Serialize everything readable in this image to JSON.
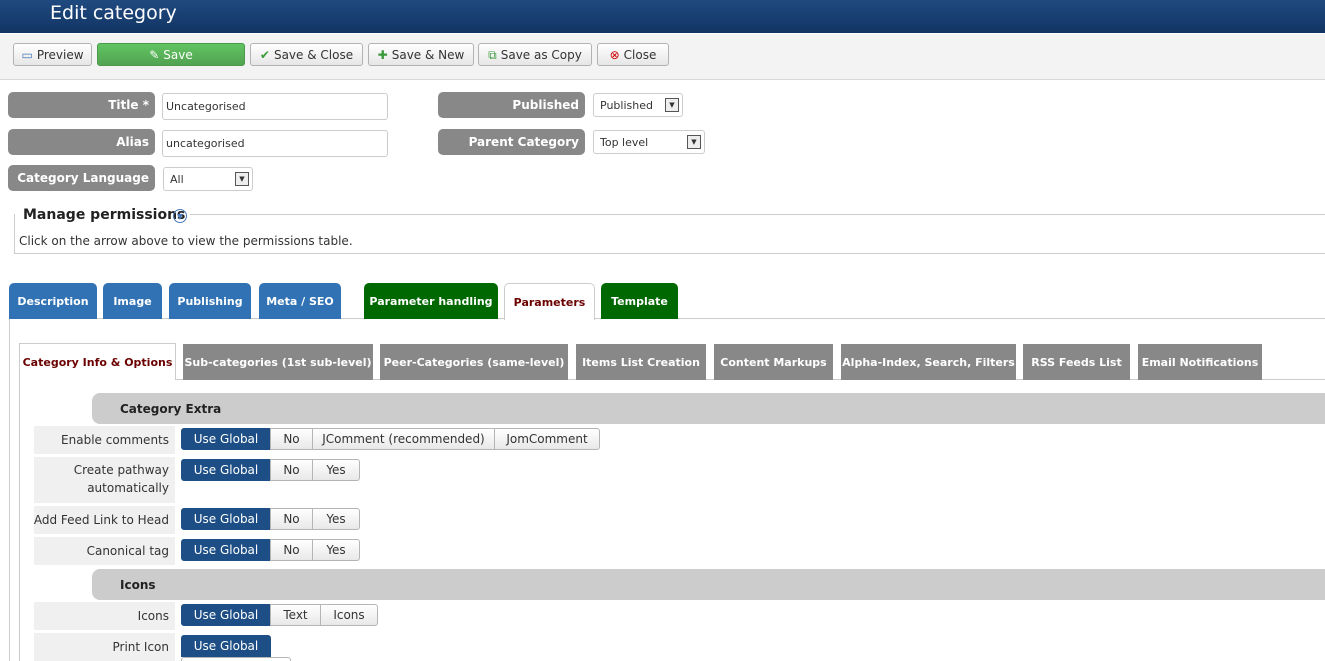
{
  "header": {
    "title": "Edit category"
  },
  "toolbar": {
    "preview": "Preview",
    "save": "Save",
    "save_close": "Save & Close",
    "save_new": "Save & New",
    "save_copy": "Save as Copy",
    "close": "Close"
  },
  "form": {
    "title_label": "Title *",
    "title_value": "Uncategorised",
    "alias_label": "Alias",
    "alias_value": "uncategorised",
    "language_label": "Category Language",
    "language_value": "All",
    "published_label": "Published",
    "published_value": "Published",
    "parent_label": "Parent Category",
    "parent_value": "Top level"
  },
  "permissions": {
    "title": "Manage permissions",
    "hint": "Click on the arrow above to view the permissions table."
  },
  "main_tabs": [
    {
      "label": "Description"
    },
    {
      "label": "Image"
    },
    {
      "label": "Publishing"
    },
    {
      "label": "Meta / SEO"
    },
    {
      "label": "Parameter handling"
    },
    {
      "label": "Parameters"
    },
    {
      "label": "Template"
    }
  ],
  "sub_tabs": [
    {
      "label": "Category Info & Options"
    },
    {
      "label": "Sub-categories (1st sub-level)"
    },
    {
      "label": "Peer-Categories (same-level)"
    },
    {
      "label": "Items List Creation"
    },
    {
      "label": "Content Markups"
    },
    {
      "label": "Alpha-Index, Search, Filters"
    },
    {
      "label": "RSS Feeds List"
    },
    {
      "label": "Email Notifications"
    }
  ],
  "sections": {
    "category_extra": "Category Extra",
    "icons": "Icons"
  },
  "params": {
    "enable_comments": {
      "label": "Enable comments",
      "options": [
        "Use Global",
        "No",
        "JComment (recommended)",
        "JomComment"
      ]
    },
    "create_pathway": {
      "label": "Create pathway automatically",
      "options": [
        "Use Global",
        "No",
        "Yes"
      ]
    },
    "feed_link": {
      "label": "Add Feed Link to Head",
      "options": [
        "Use Global",
        "No",
        "Yes"
      ]
    },
    "canonical": {
      "label": "Canonical tag",
      "options": [
        "Use Global",
        "No",
        "Yes"
      ]
    },
    "icons": {
      "label": "Icons",
      "options": [
        "Use Global",
        "Text",
        "Icons"
      ]
    },
    "print_icon": {
      "label": "Print Icon",
      "options": [
        "Use Global"
      ]
    }
  }
}
